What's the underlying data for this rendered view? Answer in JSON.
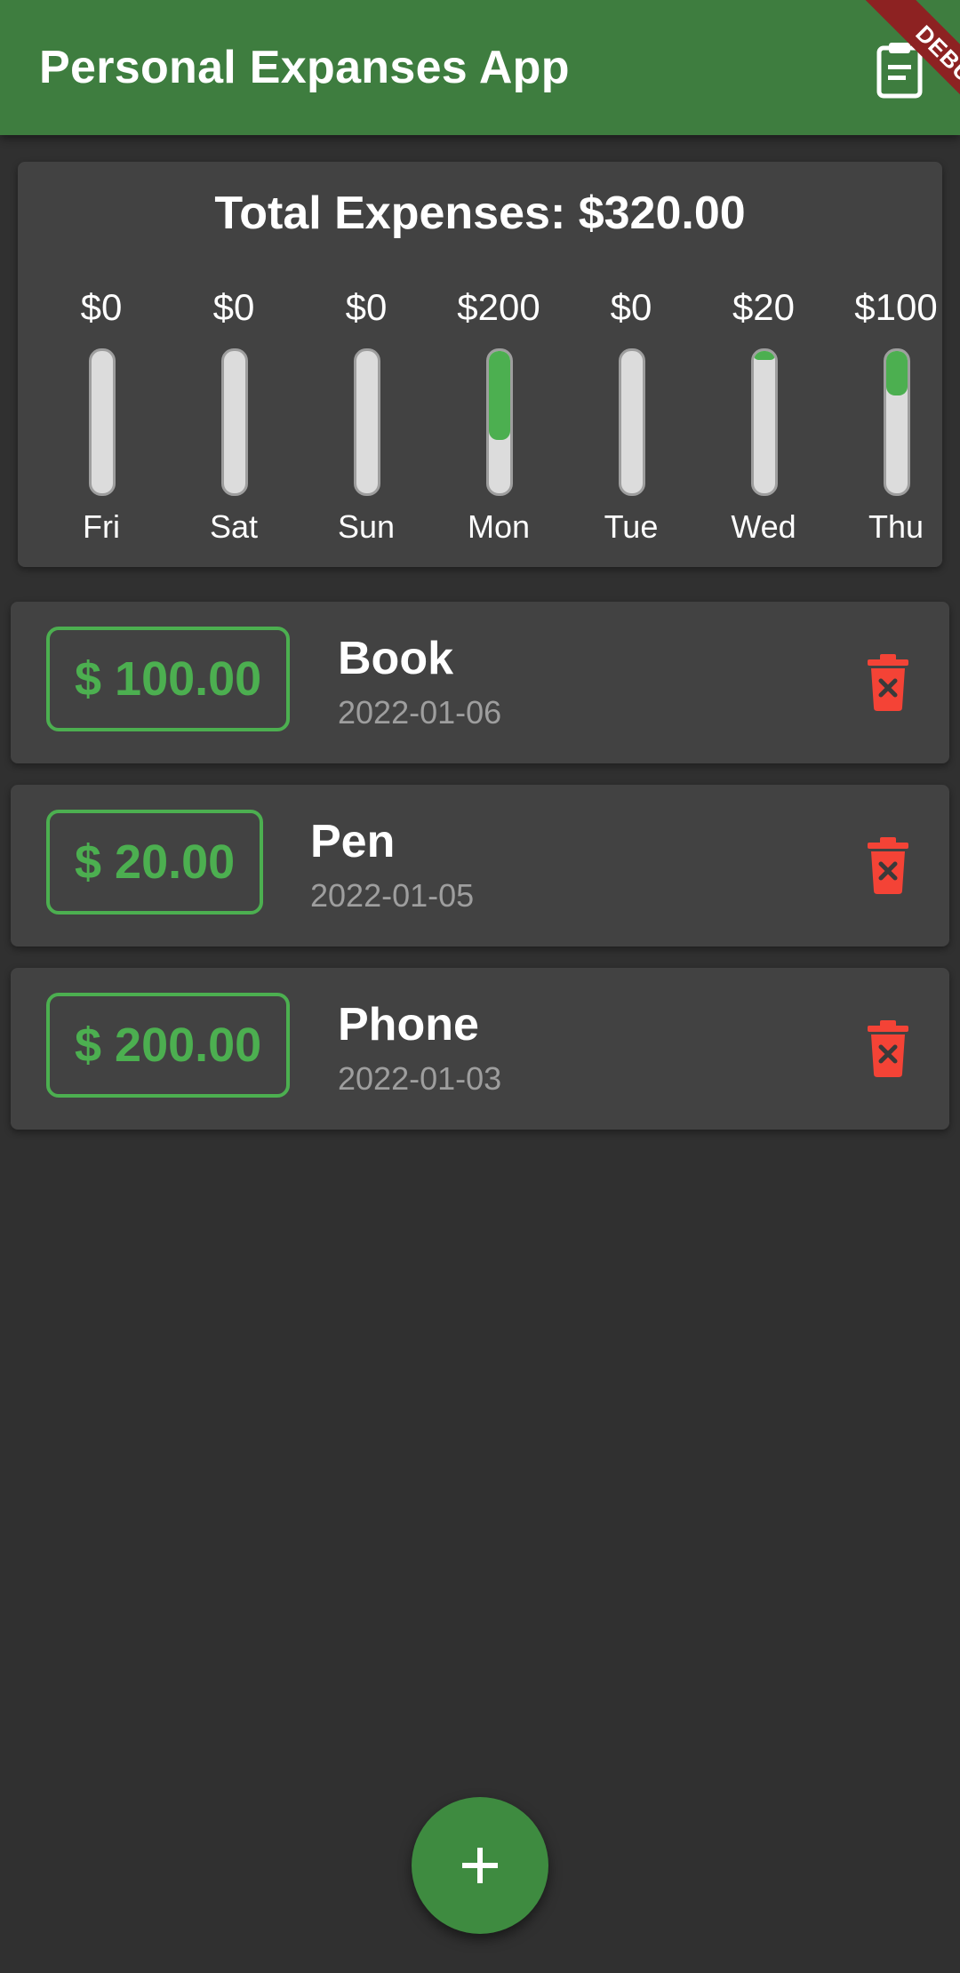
{
  "app_bar": {
    "title": "Personal Expanses App",
    "action_icon": "calendar-clipboard-icon",
    "debug_banner": "DEBUG"
  },
  "chart": {
    "total_label": "Total Expenses: $320.00",
    "bars": [
      {
        "day": "Fri",
        "amount_label": "$0",
        "fill_fraction": 0.0
      },
      {
        "day": "Sat",
        "amount_label": "$0",
        "fill_fraction": 0.0
      },
      {
        "day": "Sun",
        "amount_label": "$0",
        "fill_fraction": 0.0
      },
      {
        "day": "Mon",
        "amount_label": "$200",
        "fill_fraction": 0.625
      },
      {
        "day": "Tue",
        "amount_label": "$0",
        "fill_fraction": 0.0
      },
      {
        "day": "Wed",
        "amount_label": "$20",
        "fill_fraction": 0.0625
      },
      {
        "day": "Thu",
        "amount_label": "$100",
        "fill_fraction": 0.3125
      }
    ]
  },
  "transactions": [
    {
      "amount": "$ 100.00",
      "title": "Book",
      "date": "2022-01-06",
      "delete_icon": "trash-delete-icon"
    },
    {
      "amount": "$ 20.00",
      "title": "Pen",
      "date": "2022-01-05",
      "delete_icon": "trash-delete-icon"
    },
    {
      "amount": "$ 200.00",
      "title": "Phone",
      "date": "2022-01-03",
      "delete_icon": "trash-delete-icon"
    }
  ],
  "fab": {
    "icon": "plus-icon"
  },
  "colors": {
    "primary": "#3e7d3f",
    "accent_green": "#4caf50",
    "delete_red": "#f44336",
    "background": "#303030",
    "card": "#424242"
  }
}
